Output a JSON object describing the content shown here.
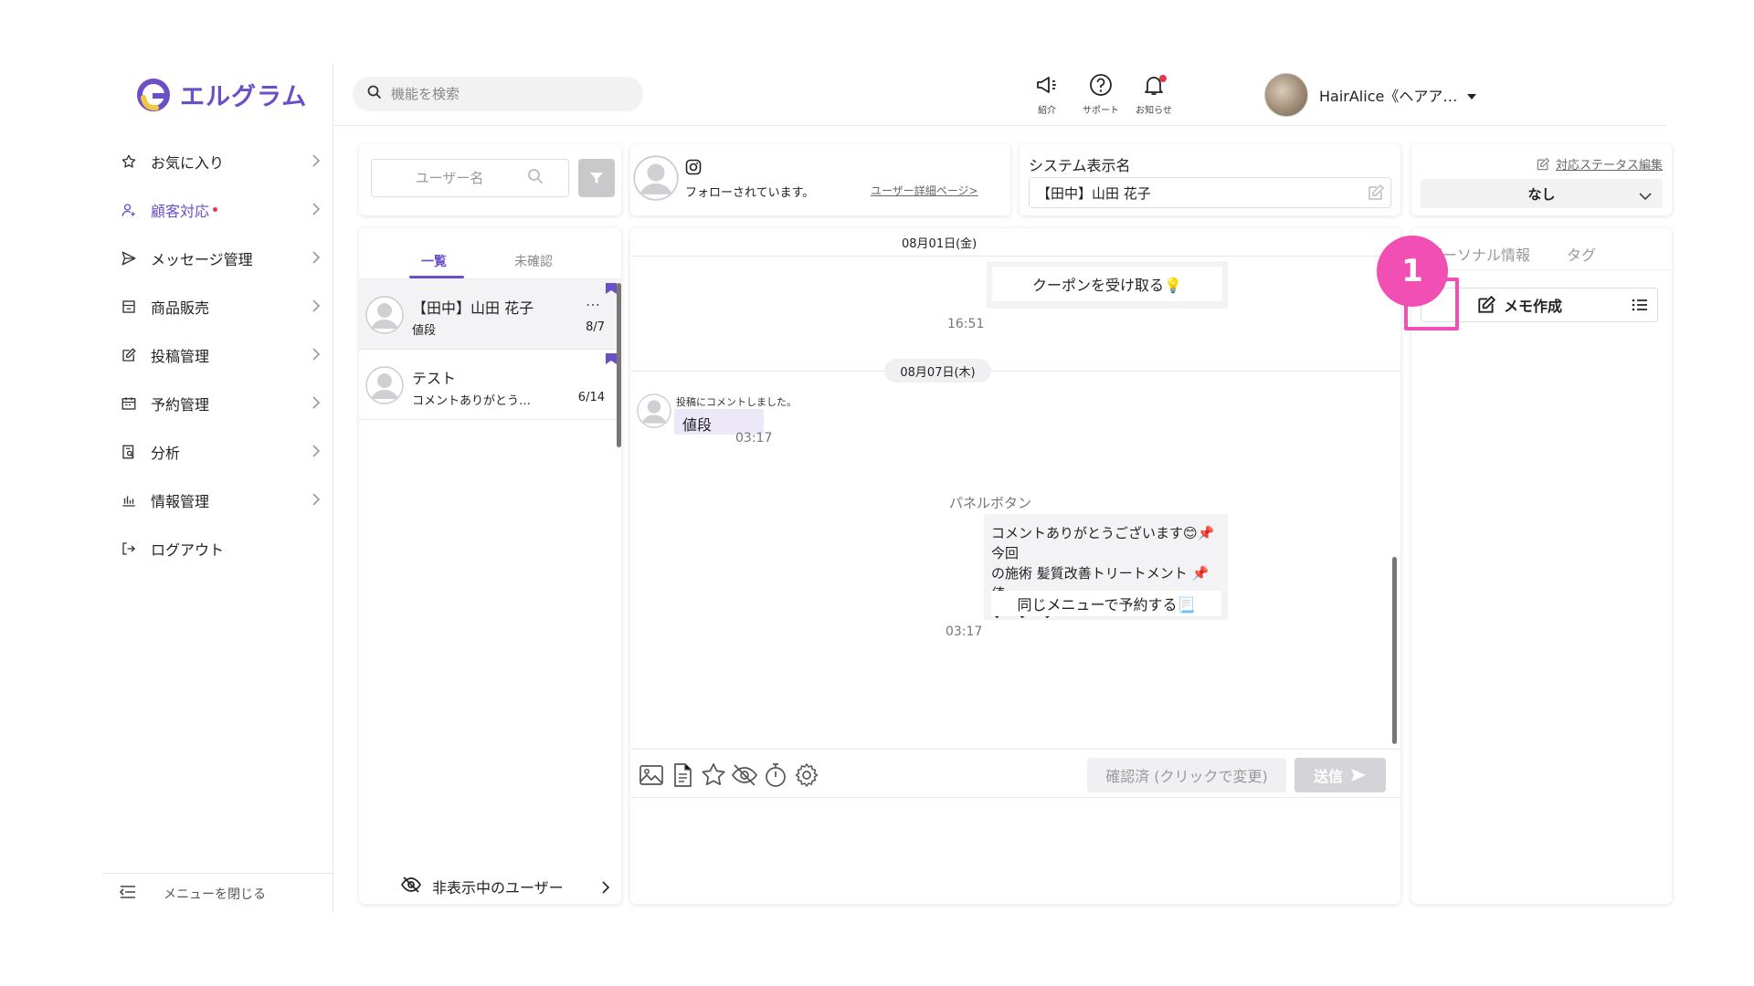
{
  "app": {
    "logo_text": "エルグラム",
    "brand_color": "#6a4fc6",
    "highlight_color": "#f04fb6"
  },
  "sidebar": {
    "items": [
      {
        "label": "お気に入り",
        "icon": "star-icon"
      },
      {
        "label": "顧客対応",
        "icon": "person-icon",
        "active": true,
        "has_dot": true
      },
      {
        "label": "メッセージ管理",
        "icon": "send-icon"
      },
      {
        "label": "商品販売",
        "icon": "store-icon"
      },
      {
        "label": "投稿管理",
        "icon": "edit-icon"
      },
      {
        "label": "予約管理",
        "icon": "calendar-icon"
      },
      {
        "label": "分析",
        "icon": "report-icon"
      },
      {
        "label": "情報管理",
        "icon": "bar-chart-icon"
      },
      {
        "label": "ログアウト",
        "icon": "logout-icon"
      }
    ],
    "close_menu": "メニューを閉じる"
  },
  "header": {
    "search_placeholder": "機能を検索",
    "intro_label": "紹介",
    "support_label": "サポート",
    "news_label": "お知らせ",
    "username": "HairAlice《ヘアア…"
  },
  "user_panel": {
    "search_placeholder": "ユーザー名",
    "tab_all": "一覧",
    "tab_unconfirmed": "未確認",
    "users": [
      {
        "name": "【田中】山田 花子",
        "last_message": "値段",
        "date": "8/7",
        "menu": "…"
      },
      {
        "name": "テスト",
        "last_message": "コメントありがとう…",
        "date": "6/14"
      }
    ],
    "hidden_users_label": "非表示中のユーザー"
  },
  "profile": {
    "follow_status": "フォローされています。",
    "detail_link": "ユーザー詳細ページ>"
  },
  "system_name": {
    "title": "システム表示名",
    "value": "【田中】山田 花子"
  },
  "status": {
    "edit_label": "対応ステータス編集",
    "value": "なし"
  },
  "chat": {
    "date1": "08月01日(金)",
    "coupon_button": "クーポンを受け取る💡",
    "time1": "16:51",
    "date2": "08月07日(木)",
    "comment_note": "投稿にコメントしました。",
    "comment_text": "値段",
    "time2": "03:17",
    "panel_button_label": "パネルボタン",
    "panel_line1": "コメントありがとうございます😊📌今回",
    "panel_line2": "の施術 髪質改善トリートメント 📌値…",
    "panel_arrows": "↓　↓　↓",
    "panel_action": "同じメニューで予約する📃",
    "time3": "03:17",
    "confirm_button": "確認済 (クリックで変更)",
    "send_button": "送信"
  },
  "right_panel": {
    "tab_personal": "パーソナル情報",
    "tab_tag": "タグ",
    "memo_button": "メモ作成"
  },
  "annotation": {
    "step": "1"
  }
}
